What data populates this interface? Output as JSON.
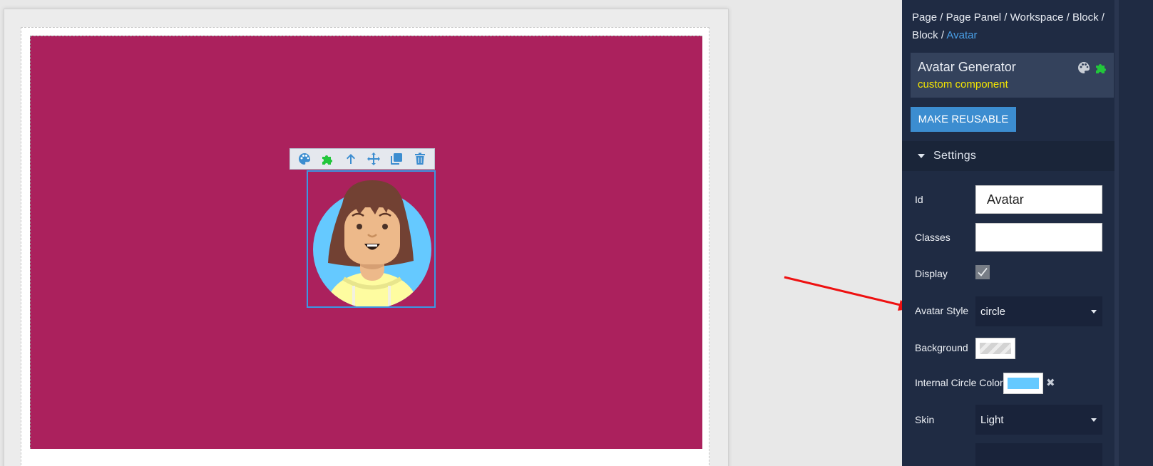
{
  "breadcrumb": {
    "items": [
      "Page",
      "Page Panel",
      "Workspace",
      "Block",
      "Block"
    ],
    "separator": " / ",
    "active": "Avatar"
  },
  "component": {
    "title": "Avatar Generator",
    "subtitle": "custom component",
    "icons": [
      "palette-icon",
      "puzzle-icon"
    ]
  },
  "make_reusable_label": "MAKE REUSABLE",
  "settings": {
    "header": "Settings",
    "id_label": "Id",
    "id_value": "Avatar",
    "classes_label": "Classes",
    "classes_value": "",
    "display_label": "Display",
    "display_checked": true,
    "avatar_style_label": "Avatar Style",
    "avatar_style_value": "circle",
    "background_label": "Background",
    "internal_circle_label": "Internal Circle Color",
    "internal_circle_color": "#65c9ff",
    "skin_label": "Skin",
    "skin_value": "Light"
  },
  "toolbar_icons": [
    "palette-icon",
    "puzzle-icon",
    "arrow-up-icon",
    "move-icon",
    "copy-icon",
    "trash-icon"
  ],
  "colors": {
    "block_bg": "#ab215d",
    "panel_bg": "#1f2b43",
    "accent": "#3c8dd0",
    "selection": "#3b97e3",
    "annotation_arrow": "#ee1111"
  }
}
